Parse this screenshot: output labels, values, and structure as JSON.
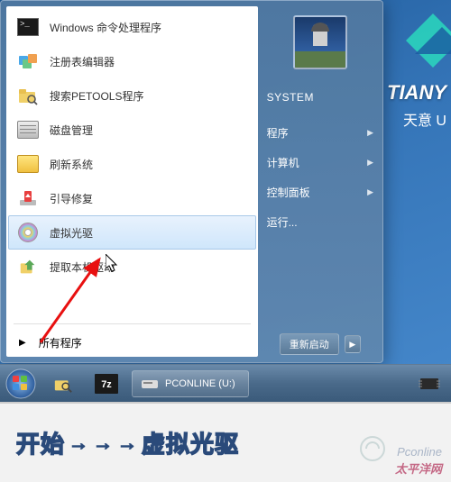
{
  "brand": {
    "line1": "TIANY",
    "line2": "天意 U"
  },
  "start_menu": {
    "items": [
      {
        "label": "Windows 命令处理程序",
        "icon": "cmd"
      },
      {
        "label": "注册表编辑器",
        "icon": "reg"
      },
      {
        "label": "搜索PETOOLS程序",
        "icon": "search"
      },
      {
        "label": "磁盘管理",
        "icon": "disk"
      },
      {
        "label": "刷新系统",
        "icon": "refresh"
      },
      {
        "label": "引导修复",
        "icon": "boot"
      },
      {
        "label": "虚拟光驱",
        "icon": "cd",
        "hover": true
      },
      {
        "label": "提取本机驱动",
        "icon": "extract"
      }
    ],
    "all_programs": "所有程序",
    "system_label": "SYSTEM",
    "links": [
      {
        "label": "程序",
        "chev": true
      },
      {
        "label": "计算机",
        "chev": true
      },
      {
        "label": "控制面板",
        "chev": true
      },
      {
        "label": "运行...",
        "chev": false
      }
    ],
    "restart": "重新启动"
  },
  "taskbar": {
    "task_label": "PCONLINE (U:)"
  },
  "caption": {
    "start": "开始",
    "target": "虚拟光驱"
  },
  "watermark": {
    "top": "Pconline",
    "bottom": "太平洋网"
  }
}
